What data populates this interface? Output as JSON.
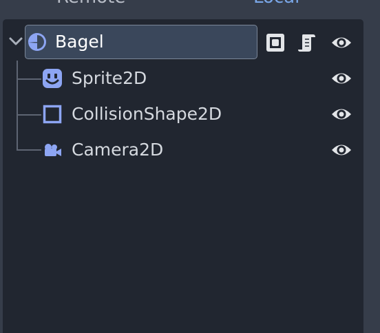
{
  "tabs": {
    "remote_label": "Remote",
    "local_label": "Local",
    "local_color": "#7aa7e8"
  },
  "scene_tree": {
    "root": {
      "label": "Bagel",
      "icon": "node2d-icon",
      "selected": true,
      "expanded": true,
      "actions": [
        "group-icon",
        "script-icon",
        "visibility-eye-icon"
      ]
    },
    "children": [
      {
        "label": "Sprite2D",
        "icon": "sprite2d-icon",
        "visible": true
      },
      {
        "label": "CollisionShape2D",
        "icon": "collision-shape2d-icon",
        "visible": true
      },
      {
        "label": "Camera2D",
        "icon": "camera2d-icon",
        "visible": true
      }
    ],
    "icon_color": "#8da5f3",
    "selection_color": "#3a475b"
  }
}
